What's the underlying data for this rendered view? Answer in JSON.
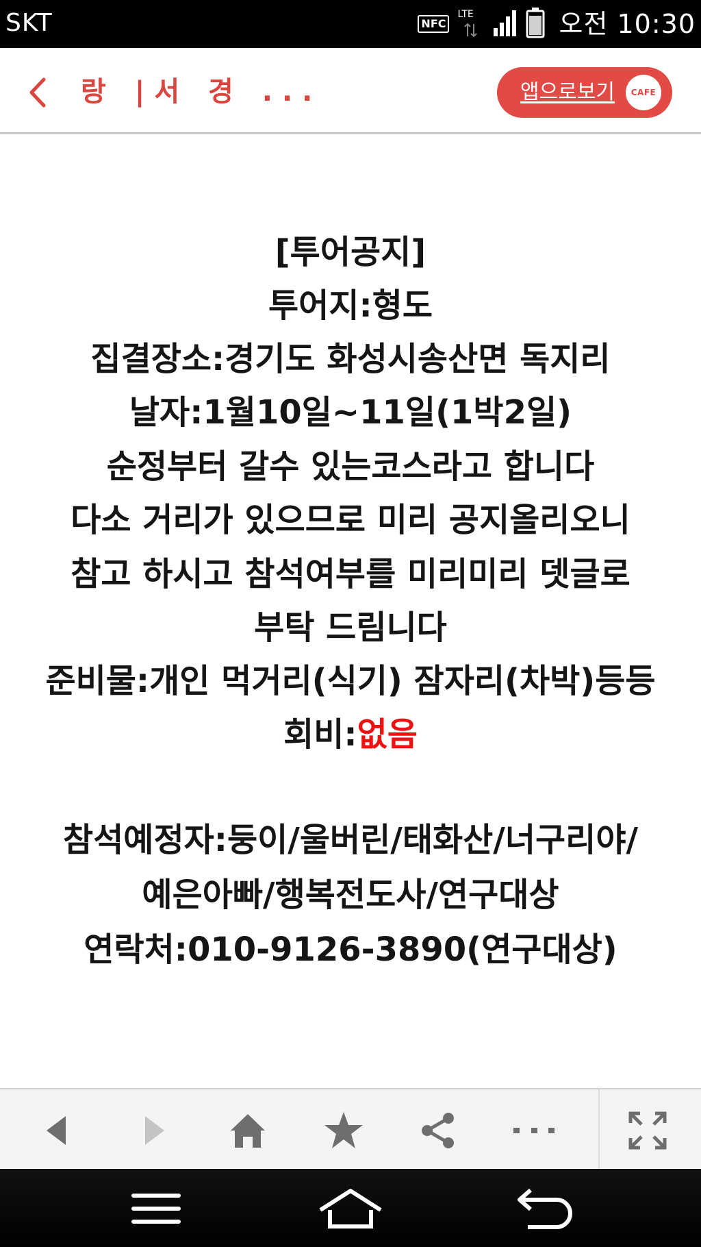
{
  "status_bar": {
    "carrier": "SKT",
    "nfc_label": "NFC",
    "network_label": "LTE",
    "time": "오전 10:30",
    "icons": [
      "nfc-icon",
      "lte-data-icon",
      "signal-icon",
      "battery-icon"
    ]
  },
  "app_bar": {
    "back_icon": "chevron-left-icon",
    "cafe_title": "랑 |서 경 ...",
    "open_app_label": "앱으로보기",
    "cafe_badge": "CAFE",
    "accent_color": "#e14a45"
  },
  "post": {
    "lines": [
      "[투어공지]",
      "투어지:형도",
      "집결장소:경기도 화성시송산면 독지리",
      "날자:1월10일~11일(1박2일)",
      "순정부터 갈수 있는코스라고 합니다",
      "다소 거리가 있으므로 미리 공지올리오니",
      "참고 하시고 참석여부를 미리미리 뎃글로",
      "부탁 드림니다",
      "준비물:개인 먹거리(식기) 잠자리(차박)등등"
    ],
    "fee_label": "회비:",
    "fee_value": "없음",
    "fee_value_color": "#ee1111",
    "attendees_line1": "참석예정자:둥이/울버린/태화산/너구리야/",
    "attendees_line2": "예은아빠/행복전도사/연구대상",
    "contact": "연락처:010-9126-3890(연구대상)"
  },
  "browser_toolbar": {
    "buttons": [
      "back-arrow-icon",
      "forward-arrow-icon",
      "home-icon",
      "star-icon",
      "share-icon",
      "more-icon",
      "fullscreen-icon"
    ]
  },
  "nav_bar": {
    "buttons": [
      "menu-icon",
      "home-outline-icon",
      "back-return-icon"
    ]
  }
}
